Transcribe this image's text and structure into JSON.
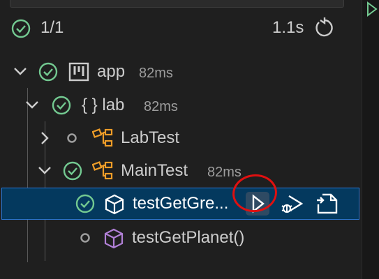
{
  "summary": {
    "count": "1/1",
    "duration": "1.1s",
    "icons": {
      "status": "pass-circle-icon",
      "rerun": "refresh-icon"
    }
  },
  "tree": {
    "app": {
      "label": "app",
      "duration": "82ms",
      "icon": "project-icon"
    },
    "lab": {
      "label": "{ } lab",
      "duration": "82ms",
      "icon": "package-icon"
    },
    "labtest": {
      "label": "LabTest",
      "icon": "class-icon"
    },
    "maintest": {
      "label": "MainTest",
      "duration": "82ms",
      "icon": "class-icon"
    },
    "testGetGreeting": {
      "label": "testGetGre...",
      "icon": "method-cube-icon",
      "actions": [
        "run-test",
        "debug-test",
        "go-to-test"
      ]
    },
    "testGetPlanet": {
      "label": "testGetPlanet()",
      "icon": "method-cube-icon"
    }
  },
  "colors": {
    "pass": "#73c991",
    "selected_bg": "#04395e",
    "focus_border": "#2b79d8",
    "class_icon": "#ee9d28",
    "method_icon": "#b180d7",
    "annotation": "#e01010"
  }
}
